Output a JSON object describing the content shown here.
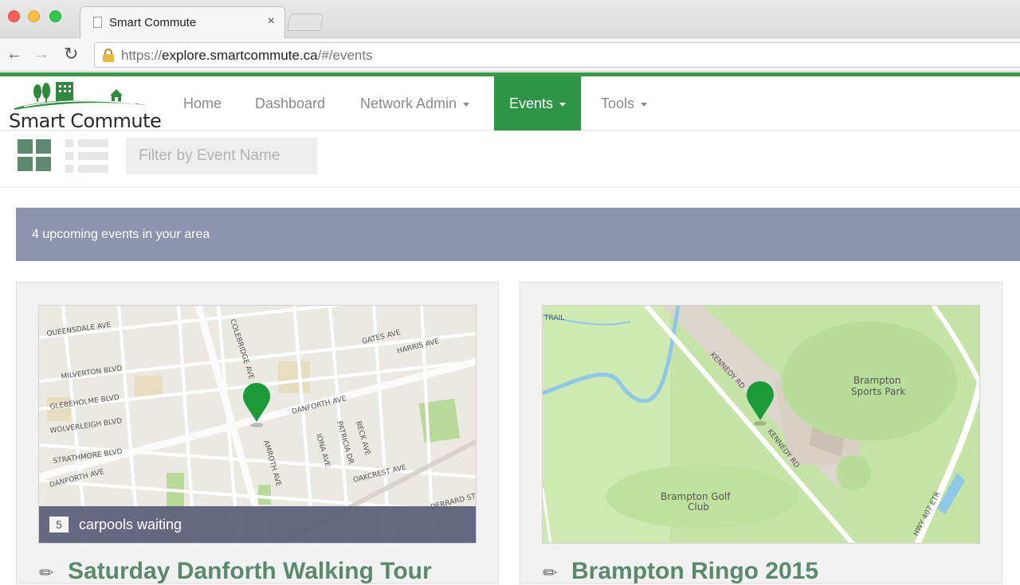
{
  "browser": {
    "tab_title": "Smart Commute",
    "tab_close": "×",
    "url_prefix": "https://",
    "url_host": "explore.smartcommute.ca",
    "url_path": "/#/events"
  },
  "logo": {
    "text": "Smart Commute",
    "color": "#2e8b3d"
  },
  "nav": {
    "items": [
      {
        "label": "Home",
        "dropdown": false,
        "active": false
      },
      {
        "label": "Dashboard",
        "dropdown": false,
        "active": false
      },
      {
        "label": "Network Admin",
        "dropdown": true,
        "active": false
      },
      {
        "label": "Events",
        "dropdown": true,
        "active": true
      },
      {
        "label": "Tools",
        "dropdown": true,
        "active": false
      }
    ],
    "active_color": "#2e9446"
  },
  "toolbar": {
    "grid_icon": "grid-view-icon",
    "list_icon": "list-view-icon",
    "filter_placeholder": "Filter by Event Name"
  },
  "banner": {
    "text": "4 upcoming events in your area",
    "color": "#8e94ae"
  },
  "events": [
    {
      "title": "Saturday Danforth Walking Tour",
      "carpools_count": "5",
      "carpools_label": "carpools waiting",
      "map_labels": [
        "QUEENSDALE AVE",
        "MILVERTON BLVD",
        "GLEBEHOLME BLVD",
        "WOLVERLEIGH BLVD",
        "STRATHMORE BLVD",
        "DANFORTH AVE",
        "DANFORTH AVE",
        "COLEBRIDGE AVE",
        "GATES AVE",
        "HARRIS AVE",
        "PATRICIA DR",
        "BECK AVE",
        "IONA AVE",
        "OAKCREST AVE",
        "AMROTH AVE",
        "DERRARD ST"
      ]
    },
    {
      "title": "Brampton Ringo 2015",
      "map_labels": [
        "Brampton",
        "Sports Park",
        "Brampton Golf",
        "Club",
        "KENNEDY RD",
        "KENNEDY RD",
        "HWY 407 ETR",
        "TRAIL"
      ]
    }
  ]
}
